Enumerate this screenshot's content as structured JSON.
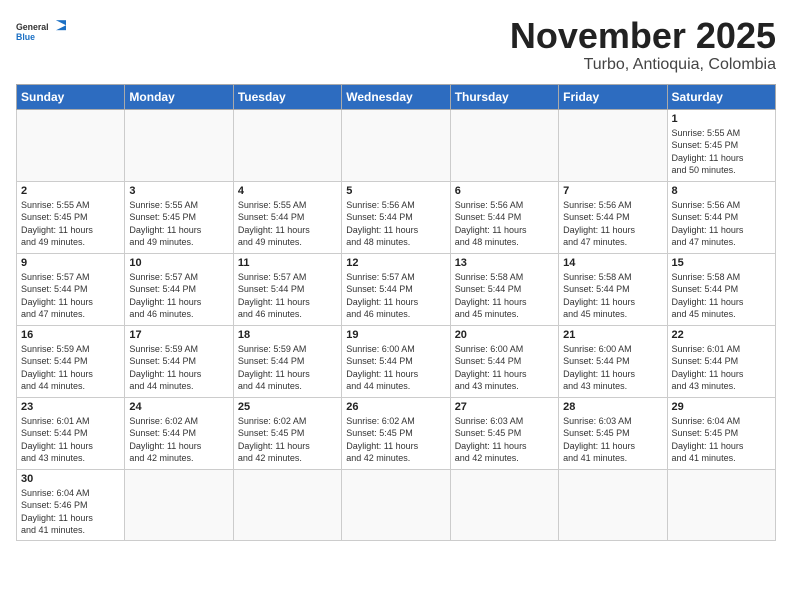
{
  "header": {
    "logo_general": "General",
    "logo_blue": "Blue",
    "month_title": "November 2025",
    "location": "Turbo, Antioquia, Colombia"
  },
  "weekdays": [
    "Sunday",
    "Monday",
    "Tuesday",
    "Wednesday",
    "Thursday",
    "Friday",
    "Saturday"
  ],
  "weeks": [
    [
      {
        "day": "",
        "info": ""
      },
      {
        "day": "",
        "info": ""
      },
      {
        "day": "",
        "info": ""
      },
      {
        "day": "",
        "info": ""
      },
      {
        "day": "",
        "info": ""
      },
      {
        "day": "",
        "info": ""
      },
      {
        "day": "1",
        "info": "Sunrise: 5:55 AM\nSunset: 5:45 PM\nDaylight: 11 hours\nand 50 minutes."
      }
    ],
    [
      {
        "day": "2",
        "info": "Sunrise: 5:55 AM\nSunset: 5:45 PM\nDaylight: 11 hours\nand 49 minutes."
      },
      {
        "day": "3",
        "info": "Sunrise: 5:55 AM\nSunset: 5:45 PM\nDaylight: 11 hours\nand 49 minutes."
      },
      {
        "day": "4",
        "info": "Sunrise: 5:55 AM\nSunset: 5:44 PM\nDaylight: 11 hours\nand 49 minutes."
      },
      {
        "day": "5",
        "info": "Sunrise: 5:56 AM\nSunset: 5:44 PM\nDaylight: 11 hours\nand 48 minutes."
      },
      {
        "day": "6",
        "info": "Sunrise: 5:56 AM\nSunset: 5:44 PM\nDaylight: 11 hours\nand 48 minutes."
      },
      {
        "day": "7",
        "info": "Sunrise: 5:56 AM\nSunset: 5:44 PM\nDaylight: 11 hours\nand 47 minutes."
      },
      {
        "day": "8",
        "info": "Sunrise: 5:56 AM\nSunset: 5:44 PM\nDaylight: 11 hours\nand 47 minutes."
      }
    ],
    [
      {
        "day": "9",
        "info": "Sunrise: 5:57 AM\nSunset: 5:44 PM\nDaylight: 11 hours\nand 47 minutes."
      },
      {
        "day": "10",
        "info": "Sunrise: 5:57 AM\nSunset: 5:44 PM\nDaylight: 11 hours\nand 46 minutes."
      },
      {
        "day": "11",
        "info": "Sunrise: 5:57 AM\nSunset: 5:44 PM\nDaylight: 11 hours\nand 46 minutes."
      },
      {
        "day": "12",
        "info": "Sunrise: 5:57 AM\nSunset: 5:44 PM\nDaylight: 11 hours\nand 46 minutes."
      },
      {
        "day": "13",
        "info": "Sunrise: 5:58 AM\nSunset: 5:44 PM\nDaylight: 11 hours\nand 45 minutes."
      },
      {
        "day": "14",
        "info": "Sunrise: 5:58 AM\nSunset: 5:44 PM\nDaylight: 11 hours\nand 45 minutes."
      },
      {
        "day": "15",
        "info": "Sunrise: 5:58 AM\nSunset: 5:44 PM\nDaylight: 11 hours\nand 45 minutes."
      }
    ],
    [
      {
        "day": "16",
        "info": "Sunrise: 5:59 AM\nSunset: 5:44 PM\nDaylight: 11 hours\nand 44 minutes."
      },
      {
        "day": "17",
        "info": "Sunrise: 5:59 AM\nSunset: 5:44 PM\nDaylight: 11 hours\nand 44 minutes."
      },
      {
        "day": "18",
        "info": "Sunrise: 5:59 AM\nSunset: 5:44 PM\nDaylight: 11 hours\nand 44 minutes."
      },
      {
        "day": "19",
        "info": "Sunrise: 6:00 AM\nSunset: 5:44 PM\nDaylight: 11 hours\nand 44 minutes."
      },
      {
        "day": "20",
        "info": "Sunrise: 6:00 AM\nSunset: 5:44 PM\nDaylight: 11 hours\nand 43 minutes."
      },
      {
        "day": "21",
        "info": "Sunrise: 6:00 AM\nSunset: 5:44 PM\nDaylight: 11 hours\nand 43 minutes."
      },
      {
        "day": "22",
        "info": "Sunrise: 6:01 AM\nSunset: 5:44 PM\nDaylight: 11 hours\nand 43 minutes."
      }
    ],
    [
      {
        "day": "23",
        "info": "Sunrise: 6:01 AM\nSunset: 5:44 PM\nDaylight: 11 hours\nand 43 minutes."
      },
      {
        "day": "24",
        "info": "Sunrise: 6:02 AM\nSunset: 5:44 PM\nDaylight: 11 hours\nand 42 minutes."
      },
      {
        "day": "25",
        "info": "Sunrise: 6:02 AM\nSunset: 5:45 PM\nDaylight: 11 hours\nand 42 minutes."
      },
      {
        "day": "26",
        "info": "Sunrise: 6:02 AM\nSunset: 5:45 PM\nDaylight: 11 hours\nand 42 minutes."
      },
      {
        "day": "27",
        "info": "Sunrise: 6:03 AM\nSunset: 5:45 PM\nDaylight: 11 hours\nand 42 minutes."
      },
      {
        "day": "28",
        "info": "Sunrise: 6:03 AM\nSunset: 5:45 PM\nDaylight: 11 hours\nand 41 minutes."
      },
      {
        "day": "29",
        "info": "Sunrise: 6:04 AM\nSunset: 5:45 PM\nDaylight: 11 hours\nand 41 minutes."
      }
    ],
    [
      {
        "day": "30",
        "info": "Sunrise: 6:04 AM\nSunset: 5:46 PM\nDaylight: 11 hours\nand 41 minutes."
      },
      {
        "day": "",
        "info": ""
      },
      {
        "day": "",
        "info": ""
      },
      {
        "day": "",
        "info": ""
      },
      {
        "day": "",
        "info": ""
      },
      {
        "day": "",
        "info": ""
      },
      {
        "day": "",
        "info": ""
      }
    ]
  ]
}
